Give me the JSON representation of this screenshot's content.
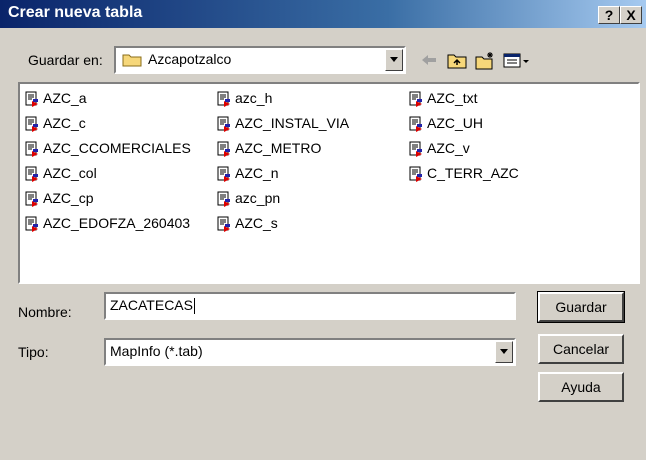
{
  "window": {
    "title": "Crear nueva tabla",
    "help_btn": "?",
    "close_btn": "X"
  },
  "location": {
    "label": "Guardar en:",
    "folder": "Azcapotzalco"
  },
  "files": [
    "AZC_a",
    "AZC_c",
    "AZC_CCOMERCIALES",
    "AZC_col",
    "AZC_cp",
    "AZC_EDOFZA_260403",
    "azc_h",
    "AZC_INSTAL_VIA",
    "AZC_METRO",
    "AZC_n",
    "azc_pn",
    "AZC_s",
    "AZC_txt",
    "AZC_UH",
    "AZC_v",
    "C_TERR_AZC"
  ],
  "form": {
    "name_label": "Nombre:",
    "name_value": "ZACATECAS",
    "type_label": "Tipo:",
    "type_value": "MapInfo (*.tab)"
  },
  "buttons": {
    "save": "Guardar",
    "cancel": "Cancelar",
    "help": "Ayuda"
  },
  "icons": [
    "folder-icon",
    "back-arrow-icon",
    "up-folder-icon",
    "new-folder-icon",
    "view-menu-icon",
    "mapinfo-table-icon"
  ]
}
